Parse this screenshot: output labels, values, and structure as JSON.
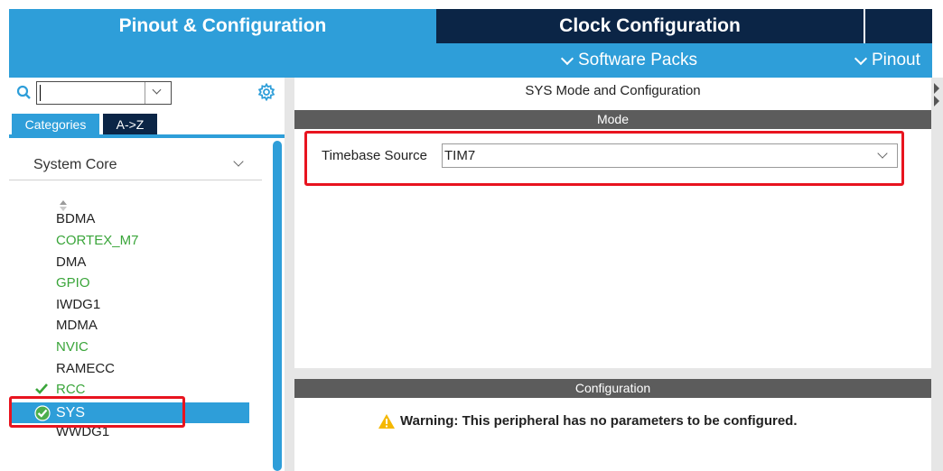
{
  "top_tabs": {
    "pinout": "Pinout & Configuration",
    "clock": "Clock Configuration"
  },
  "sub_bar": {
    "software_packs": "Software Packs",
    "pinout": "Pinout"
  },
  "sidebar": {
    "search_value": "",
    "tabs": {
      "categories": "Categories",
      "az": "A->Z"
    },
    "group": "System Core",
    "items": [
      {
        "label": "BDMA",
        "status": "none"
      },
      {
        "label": "CORTEX_M7",
        "status": "configured"
      },
      {
        "label": "DMA",
        "status": "none"
      },
      {
        "label": "GPIO",
        "status": "configured"
      },
      {
        "label": "IWDG1",
        "status": "none"
      },
      {
        "label": "MDMA",
        "status": "none"
      },
      {
        "label": "NVIC",
        "status": "configured"
      },
      {
        "label": "RAMECC",
        "status": "none"
      },
      {
        "label": "RCC",
        "status": "checked"
      },
      {
        "label": "SYS",
        "status": "selected"
      },
      {
        "label": "WWDG1",
        "status": "none"
      }
    ]
  },
  "main": {
    "title": "SYS Mode and Configuration",
    "mode_header": "Mode",
    "timebase_label": "Timebase Source",
    "timebase_value": "TIM7",
    "config_header": "Configuration",
    "warning": "Warning: This peripheral has no parameters to be configured."
  },
  "colors": {
    "accent_blue": "#2e9ed9",
    "dark_navy": "#0b2546",
    "ok_green": "#3aa53a",
    "highlight_red": "#e8141f"
  }
}
